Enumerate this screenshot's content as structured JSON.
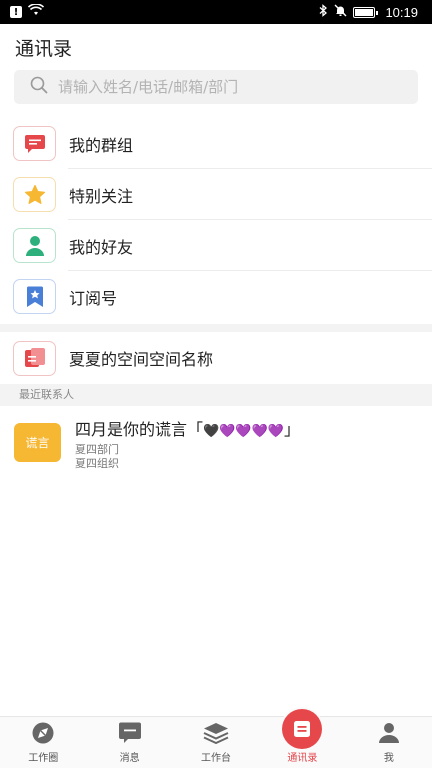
{
  "status_bar": {
    "time": "10:19",
    "icons": [
      "alert-icon",
      "wifi-icon",
      "bluetooth-icon",
      "mute-icon",
      "battery-icon"
    ],
    "battery_level": 1.0
  },
  "header": {
    "title": "通讯录"
  },
  "search": {
    "placeholder": "请输入姓名/电话/邮箱/部门"
  },
  "menu": [
    {
      "label": "我的群组",
      "icon": "group-chat-icon",
      "color": "#e5474b",
      "border": "#f0c4c4"
    },
    {
      "label": "特别关注",
      "icon": "star-icon",
      "color": "#f6b733",
      "border": "#f6deb0"
    },
    {
      "label": "我的好友",
      "icon": "friend-icon",
      "color": "#2db07b",
      "border": "#b8e3cf"
    },
    {
      "label": "订阅号",
      "icon": "subscription-icon",
      "color": "#4a7fd8",
      "border": "#c2d4f2"
    }
  ],
  "space": {
    "label": "夏夏的空间空间名称",
    "icon": "space-icon",
    "color": "#e5474b"
  },
  "recent": {
    "header": "最近联系人",
    "contacts": [
      {
        "avatar_text": "谎言",
        "name": "四月是你的谎言「",
        "hearts": "🖤💜💜💜💜",
        "name_end": "」",
        "department": "夏四部门",
        "organization": "夏四组织"
      }
    ]
  },
  "tabs": [
    {
      "label": "工作圈",
      "icon": "compass-icon",
      "active": false
    },
    {
      "label": "消息",
      "icon": "message-icon",
      "active": false
    },
    {
      "label": "工作台",
      "icon": "layers-icon",
      "active": false
    },
    {
      "label": "通讯录",
      "icon": "contacts-icon",
      "active": true
    },
    {
      "label": "我",
      "icon": "person-icon",
      "active": false
    }
  ],
  "colors": {
    "accent": "#e5474b",
    "avatar": "#f6b733"
  }
}
